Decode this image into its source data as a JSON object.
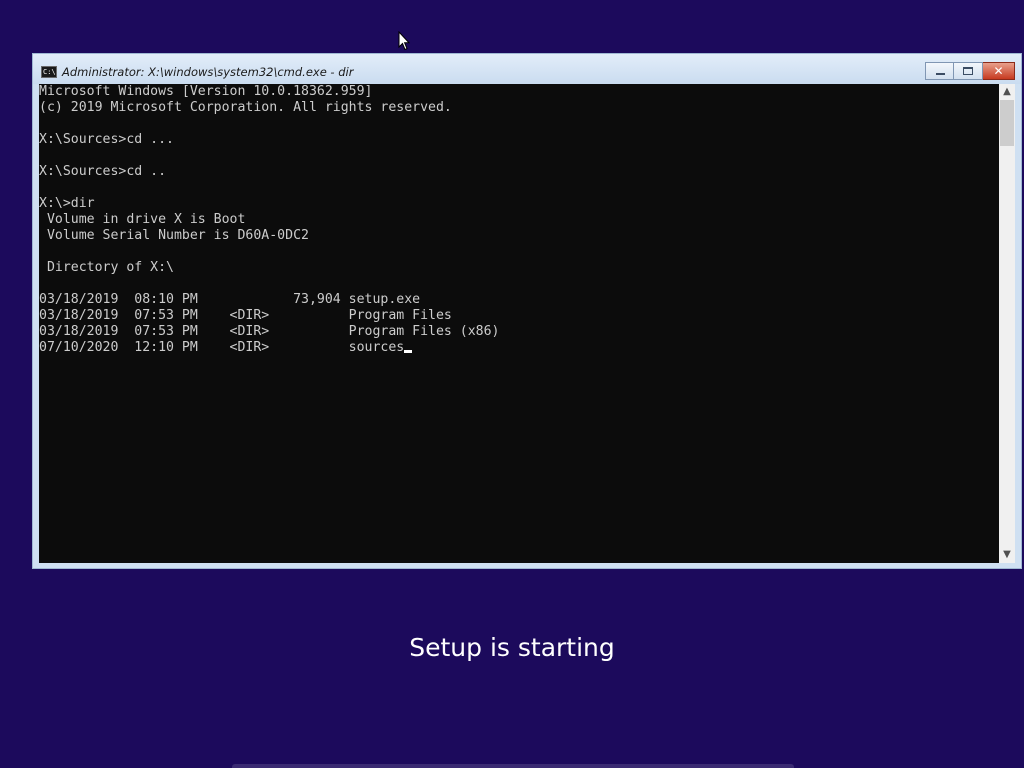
{
  "window": {
    "title": "Administrator: X:\\windows\\system32\\cmd.exe - dir",
    "icon_name": "console-app-icon",
    "icon_text": "C:\\",
    "buttons": {
      "minimize_icon": "minimize-icon",
      "maximize_icon": "maximize-icon",
      "close_icon": "close-icon",
      "close_glyph": "✕"
    }
  },
  "console": {
    "lines": [
      "Microsoft Windows [Version 10.0.18362.959]",
      "(c) 2019 Microsoft Corporation. All rights reserved.",
      "",
      "X:\\Sources>cd ...",
      "",
      "X:\\Sources>cd ..",
      "",
      "X:\\>dir",
      " Volume in drive X is Boot",
      " Volume Serial Number is D60A-0DC2",
      "",
      " Directory of X:\\",
      "",
      "03/18/2019  08:10 PM            73,904 setup.exe",
      "03/18/2019  07:53 PM    <DIR>          Program Files",
      "03/18/2019  07:53 PM    <DIR>          Program Files (x86)",
      "07/10/2020  12:10 PM    <DIR>          sources"
    ],
    "scrollbar": {
      "up_glyph": "▲",
      "down_glyph": "▼"
    }
  },
  "status": {
    "message": "Setup is starting"
  },
  "colors": {
    "desktop_background": "#1c0a5c",
    "console_background": "#0c0c0c",
    "console_text": "#cccccc",
    "close_button": "#c73a20"
  }
}
